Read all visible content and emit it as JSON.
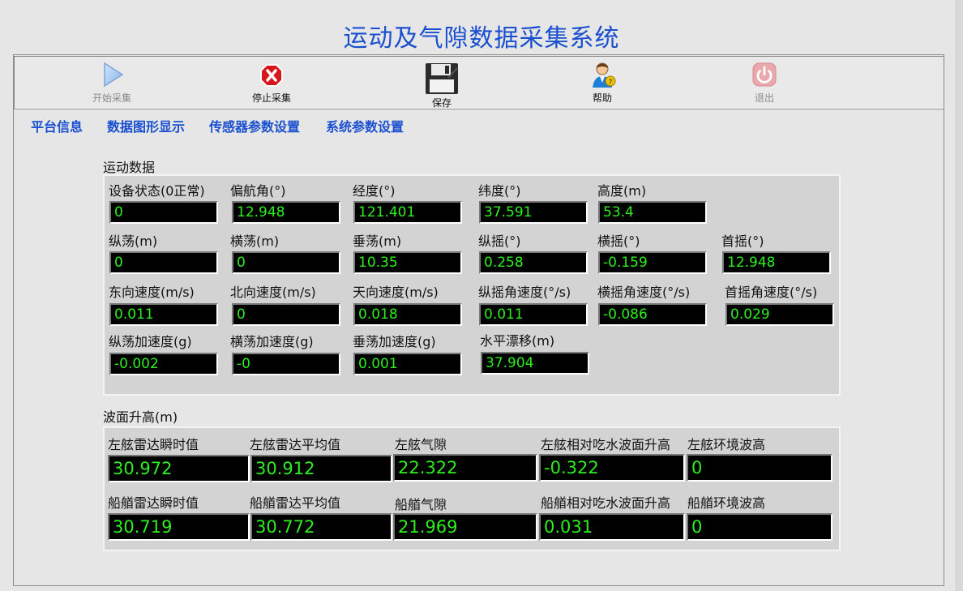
{
  "title": "运动及气隙数据采集系统",
  "toolbar": {
    "start_label": "开始采集",
    "stop_label": "停止采集",
    "save_label": "保存",
    "help_label": "帮助",
    "exit_label": "退出"
  },
  "tabs": [
    "平台信息",
    "数据图形显示",
    "传感器参数设置",
    "系统参数设置"
  ],
  "motion": {
    "section_label": "运动数据",
    "fields": [
      {
        "label": "设备状态(0正常)",
        "value": "0"
      },
      {
        "label": "偏航角(°)",
        "value": "12.948"
      },
      {
        "label": "经度(°)",
        "value": "121.401"
      },
      {
        "label": "纬度(°)",
        "value": "37.591"
      },
      {
        "label": "高度(m)",
        "value": "53.4"
      },
      {
        "label": "纵荡(m)",
        "value": "0"
      },
      {
        "label": "横荡(m)",
        "value": "0"
      },
      {
        "label": "垂荡(m)",
        "value": "10.35"
      },
      {
        "label": "纵摇(°)",
        "value": "0.258"
      },
      {
        "label": "横摇(°)",
        "value": "-0.159"
      },
      {
        "label": "首摇(°)",
        "value": "12.948"
      },
      {
        "label": "东向速度(m/s)",
        "value": "0.011"
      },
      {
        "label": "北向速度(m/s)",
        "value": "0"
      },
      {
        "label": "天向速度(m/s)",
        "value": "0.018"
      },
      {
        "label": "纵摇角速度(°/s)",
        "value": "0.011"
      },
      {
        "label": "横摇角速度(°/s)",
        "value": "-0.086"
      },
      {
        "label": "首摇角速度(°/s)",
        "value": "0.029"
      },
      {
        "label": "纵荡加速度(g)",
        "value": "-0.002"
      },
      {
        "label": "横荡加速度(g)",
        "value": "-0"
      },
      {
        "label": "垂荡加速度(g)",
        "value": "0.001"
      },
      {
        "label": "水平漂移(m)",
        "value": "37.904"
      }
    ]
  },
  "wave": {
    "section_label": "波面升高(m)",
    "fields": [
      {
        "label": "左舷雷达瞬时值",
        "value": "30.972"
      },
      {
        "label": "左舷雷达平均值",
        "value": "30.912"
      },
      {
        "label": "左舷气隙",
        "value": "22.322"
      },
      {
        "label": "左舷相对吃水波面升高",
        "value": "-0.322"
      },
      {
        "label": "左舷环境波高",
        "value": "0"
      },
      {
        "label": "船艏雷达瞬时值",
        "value": "30.719"
      },
      {
        "label": "船艏雷达平均值",
        "value": "30.772"
      },
      {
        "label": "船艏气隙",
        "value": "21.969"
      },
      {
        "label": "船艏相对吃水波面升高",
        "value": "0.031"
      },
      {
        "label": "船艏环境波高",
        "value": "0"
      }
    ]
  },
  "colors": {
    "title": "#1a4fd0",
    "tab": "#1a4fd0",
    "indicator_bg": "#000000",
    "indicator_text": "#2cf01c",
    "panel_bg": "#d3d3d3",
    "window_bg": "#e6e6e6"
  },
  "icons": {
    "start": "play-icon",
    "stop": "stop-icon",
    "save": "floppy-disk-icon",
    "help": "help-user-icon",
    "exit": "power-icon"
  }
}
